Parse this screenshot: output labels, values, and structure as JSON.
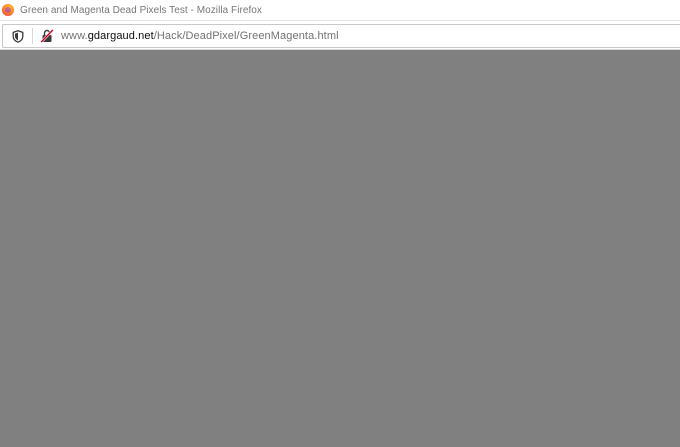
{
  "window": {
    "title": "Green and Magenta Dead Pixels Test - Mozilla Firefox",
    "app_icon": "firefox-icon"
  },
  "navbar": {
    "url_prefix": "www.",
    "url_domain": "gdargaud.net",
    "url_path": "/Hack/DeadPixel/GreenMagenta.html",
    "icons": [
      "shield-icon",
      "insecure-connection-icon"
    ]
  },
  "content": {
    "background_color": "#808080"
  }
}
